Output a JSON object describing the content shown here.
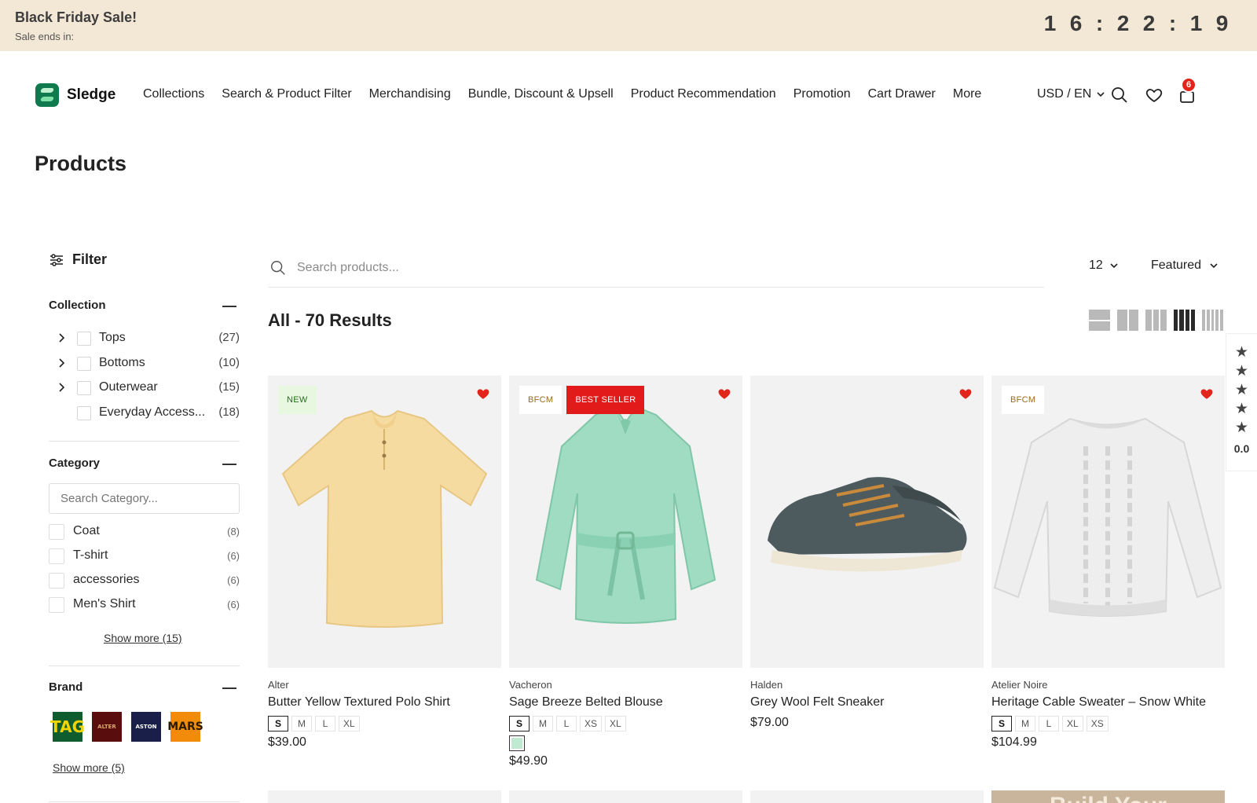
{
  "announcement": {
    "title": "Black Friday Sale!",
    "subtitle": "Sale ends in:",
    "countdown": [
      "1",
      "6",
      ":",
      "2",
      "2",
      ":",
      "1",
      "9"
    ]
  },
  "header": {
    "brand": "Sledge",
    "nav": [
      "Collections",
      "Search & Product Filter",
      "Merchandising",
      "Bundle, Discount & Upsell",
      "Product Recommendation",
      "Promotion",
      "Cart Drawer",
      "More"
    ],
    "locale": "USD / EN",
    "wishlist_count": "6",
    "icons": [
      "search-icon",
      "heart-icon",
      "bag-icon"
    ]
  },
  "page": {
    "title": "Products"
  },
  "filter": {
    "heading": "Filter",
    "collection": {
      "title": "Collection",
      "items": [
        {
          "label": "Tops",
          "count": "(27)",
          "expandable": true
        },
        {
          "label": "Bottoms",
          "count": "(10)",
          "expandable": true
        },
        {
          "label": "Outerwear",
          "count": "(15)",
          "expandable": true
        },
        {
          "label": "Everyday Access...",
          "count": "(18)",
          "expandable": false
        }
      ]
    },
    "category": {
      "title": "Category",
      "search_placeholder": "Search Category...",
      "items": [
        {
          "label": "Coat",
          "count": "(8)"
        },
        {
          "label": "T-shirt",
          "count": "(6)"
        },
        {
          "label": "accessories",
          "count": "(6)"
        },
        {
          "label": "Men's Shirt",
          "count": "(6)"
        }
      ],
      "show_more": "Show more (15)"
    },
    "brand": {
      "title": "Brand",
      "items": [
        {
          "label": "TAG",
          "bg": "#0f5c2e",
          "fg": "#f2d500"
        },
        {
          "label": "ALTER",
          "bg": "#5a0d0d",
          "fg": "#d9a56b"
        },
        {
          "label": "ASTON",
          "bg": "#1a1f4a",
          "fg": "#ffffff"
        },
        {
          "label": "MARS",
          "bg": "#f28a0a",
          "fg": "#2a1a00"
        }
      ],
      "show_more": "Show more (5)"
    }
  },
  "toolbar": {
    "search_placeholder": "Search products...",
    "per_page": "12",
    "sort": "Featured",
    "results": "All - 70 Results"
  },
  "rating_widget": {
    "value": "0.0"
  },
  "products": [
    {
      "vendor": "Alter",
      "name": "Butter Yellow Textured Polo Shirt",
      "tags": [
        {
          "label": "NEW",
          "kind": "new"
        }
      ],
      "sizes": [
        "S",
        "M",
        "L",
        "XL"
      ],
      "price": "$39.00",
      "swatch": false
    },
    {
      "vendor": "Vacheron",
      "name": "Sage Breeze Belted Blouse",
      "tags": [
        {
          "label": "BFCM",
          "kind": "bfcm"
        },
        {
          "label": "BEST SELLER",
          "kind": "best"
        }
      ],
      "sizes": [
        "S",
        "M",
        "L",
        "XS",
        "XL"
      ],
      "price": "$49.90",
      "swatch": true
    },
    {
      "vendor": "Halden",
      "name": "Grey Wool Felt Sneaker",
      "tags": [],
      "sizes": [],
      "price": "$79.00",
      "swatch": false
    },
    {
      "vendor": "Atelier Noire",
      "name": "Heritage Cable Sweater – Snow White",
      "tags": [
        {
          "label": "BFCM",
          "kind": "bfcm"
        }
      ],
      "sizes": [
        "S",
        "M",
        "L",
        "XL",
        "XS"
      ],
      "price": "$104.99",
      "swatch": false
    }
  ],
  "promo_tile": {
    "text": "Build Your"
  },
  "colors": {
    "announce_bg": "#f3e8d6",
    "sale_red": "#e21a1a",
    "heart": "#e1251b"
  }
}
